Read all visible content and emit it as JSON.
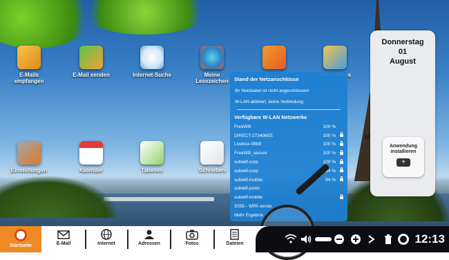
{
  "desktop_icons": [
    {
      "label": "E-Mails empfangen",
      "icon": "envelope-download-icon"
    },
    {
      "label": "E-Mail senden",
      "icon": "envelope-send-icon"
    },
    {
      "label": "Internet-Suche",
      "icon": "globe-www-icon"
    },
    {
      "label": "Meine Lesezeichen",
      "icon": "bookmark-icon"
    },
    {
      "label": "",
      "icon": "address-book-icon"
    },
    {
      "label": "Meine Fotos",
      "icon": "photos-icon"
    },
    {
      "label": "Einstellungen",
      "icon": "tools-icon"
    },
    {
      "label": "Kalender",
      "icon": "calendar-icon"
    },
    {
      "label": "Tabellen",
      "icon": "spreadsheet-icon"
    },
    {
      "label": "Schreiben",
      "icon": "document-icon"
    }
  ],
  "clock_widget": {
    "day": "Donnerstag",
    "date": "01",
    "month": "August"
  },
  "app_widget": {
    "label": "Anwendung installieren"
  },
  "network_panel": {
    "title": "Stand der Netzanschlüsse",
    "cable_status": "Ihr Netzkabel ist nicht angeschlossen",
    "wlan_status": "W-LAN aktiviert, keine Verbindung",
    "wifi_header": "Verfügbare W-LAN Netzwerke",
    "networks": [
      {
        "name": "FreeWifi",
        "signal": "100 %",
        "locked": false
      },
      {
        "name": "DIRECT-273406EE",
        "signal": "100 %",
        "locked": true
      },
      {
        "name": "Livebox-08b8",
        "signal": "100 %",
        "locked": true
      },
      {
        "name": "FreeWifi_secure",
        "signal": "100 %",
        "locked": true
      },
      {
        "name": "subwifi-corp",
        "signal": "100 %",
        "locked": true
      },
      {
        "name": "subwifi-corp",
        "signal": "94 %",
        "locked": true
      },
      {
        "name": "subwifi-mobile",
        "signal": "94 %",
        "locked": true
      },
      {
        "name": "subwifi-proto",
        "signal": "",
        "locked": false
      },
      {
        "name": "subwifi-mobile",
        "signal": "",
        "locked": true
      },
      {
        "name": "SSID - WPA verste",
        "signal": "",
        "locked": false
      },
      {
        "name": "Mehr Ergebnis",
        "signal": "",
        "locked": false
      }
    ]
  },
  "taskbar": {
    "start": "Startseite",
    "items": [
      {
        "label": "E-Mail",
        "icon": "envelope-icon"
      },
      {
        "label": "Internet",
        "icon": "globe-icon"
      },
      {
        "label": "Adressen",
        "icon": "contacts-icon"
      },
      {
        "label": "Fotos",
        "icon": "camera-icon"
      },
      {
        "label": "Dateien",
        "icon": "files-icon"
      }
    ]
  },
  "tray": {
    "time": "12:13"
  },
  "colors": {
    "start": "#f08a24",
    "panel": "#1e80d2",
    "tray": "#0b0d12"
  }
}
